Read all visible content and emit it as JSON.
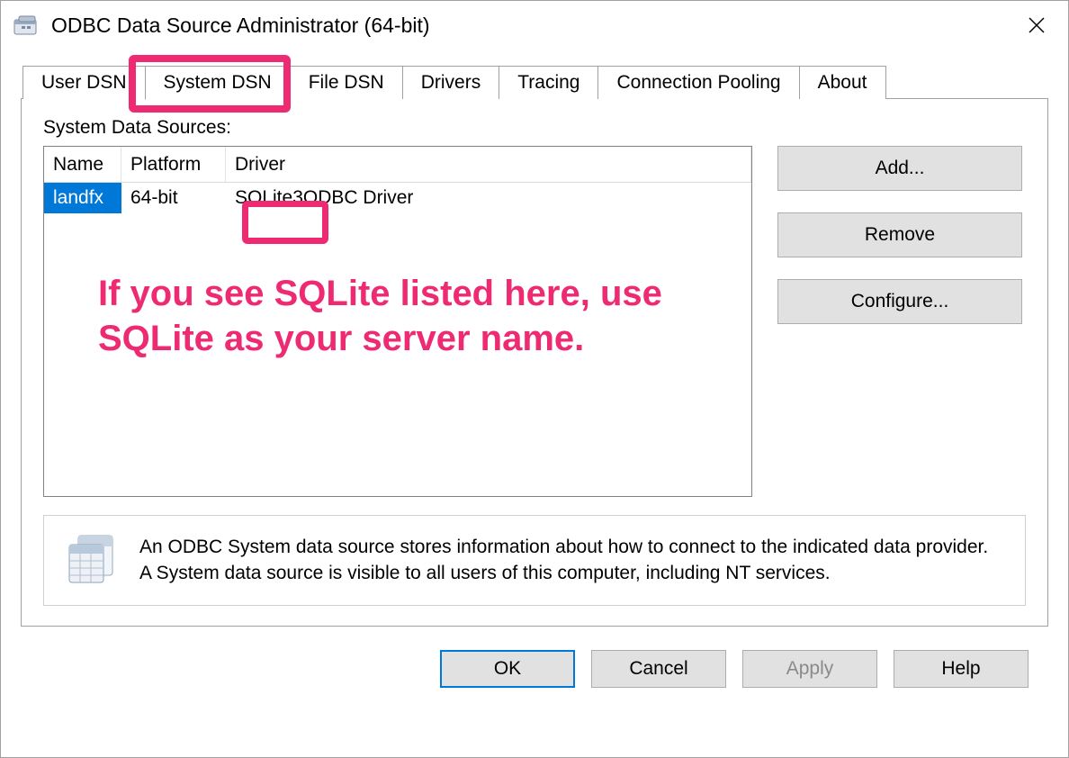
{
  "window": {
    "title": "ODBC Data Source Administrator (64-bit)"
  },
  "tabs": [
    {
      "label": "User DSN"
    },
    {
      "label": "System DSN"
    },
    {
      "label": "File DSN"
    },
    {
      "label": "Drivers"
    },
    {
      "label": "Tracing"
    },
    {
      "label": "Connection Pooling"
    },
    {
      "label": "About"
    }
  ],
  "section_label": "System Data Sources:",
  "columns": {
    "name": "Name",
    "platform": "Platform",
    "driver": "Driver"
  },
  "rows": [
    {
      "name": "landfx",
      "platform": "64-bit",
      "driver_part1": "SQLite3",
      "driver_part2": " ODBC Driver"
    }
  ],
  "side_buttons": {
    "add": "Add...",
    "remove": "Remove",
    "configure": "Configure..."
  },
  "info": {
    "line1": "An ODBC System data source stores information about how to connect to the indicated data provider.",
    "line2": "A System data source is visible to all users of this computer, including NT services."
  },
  "footer": {
    "ok": "OK",
    "cancel": "Cancel",
    "apply": "Apply",
    "help": "Help"
  },
  "annotation": {
    "line1": "If you see SQLite listed here, use",
    "line2": "SQLite as your server name."
  }
}
